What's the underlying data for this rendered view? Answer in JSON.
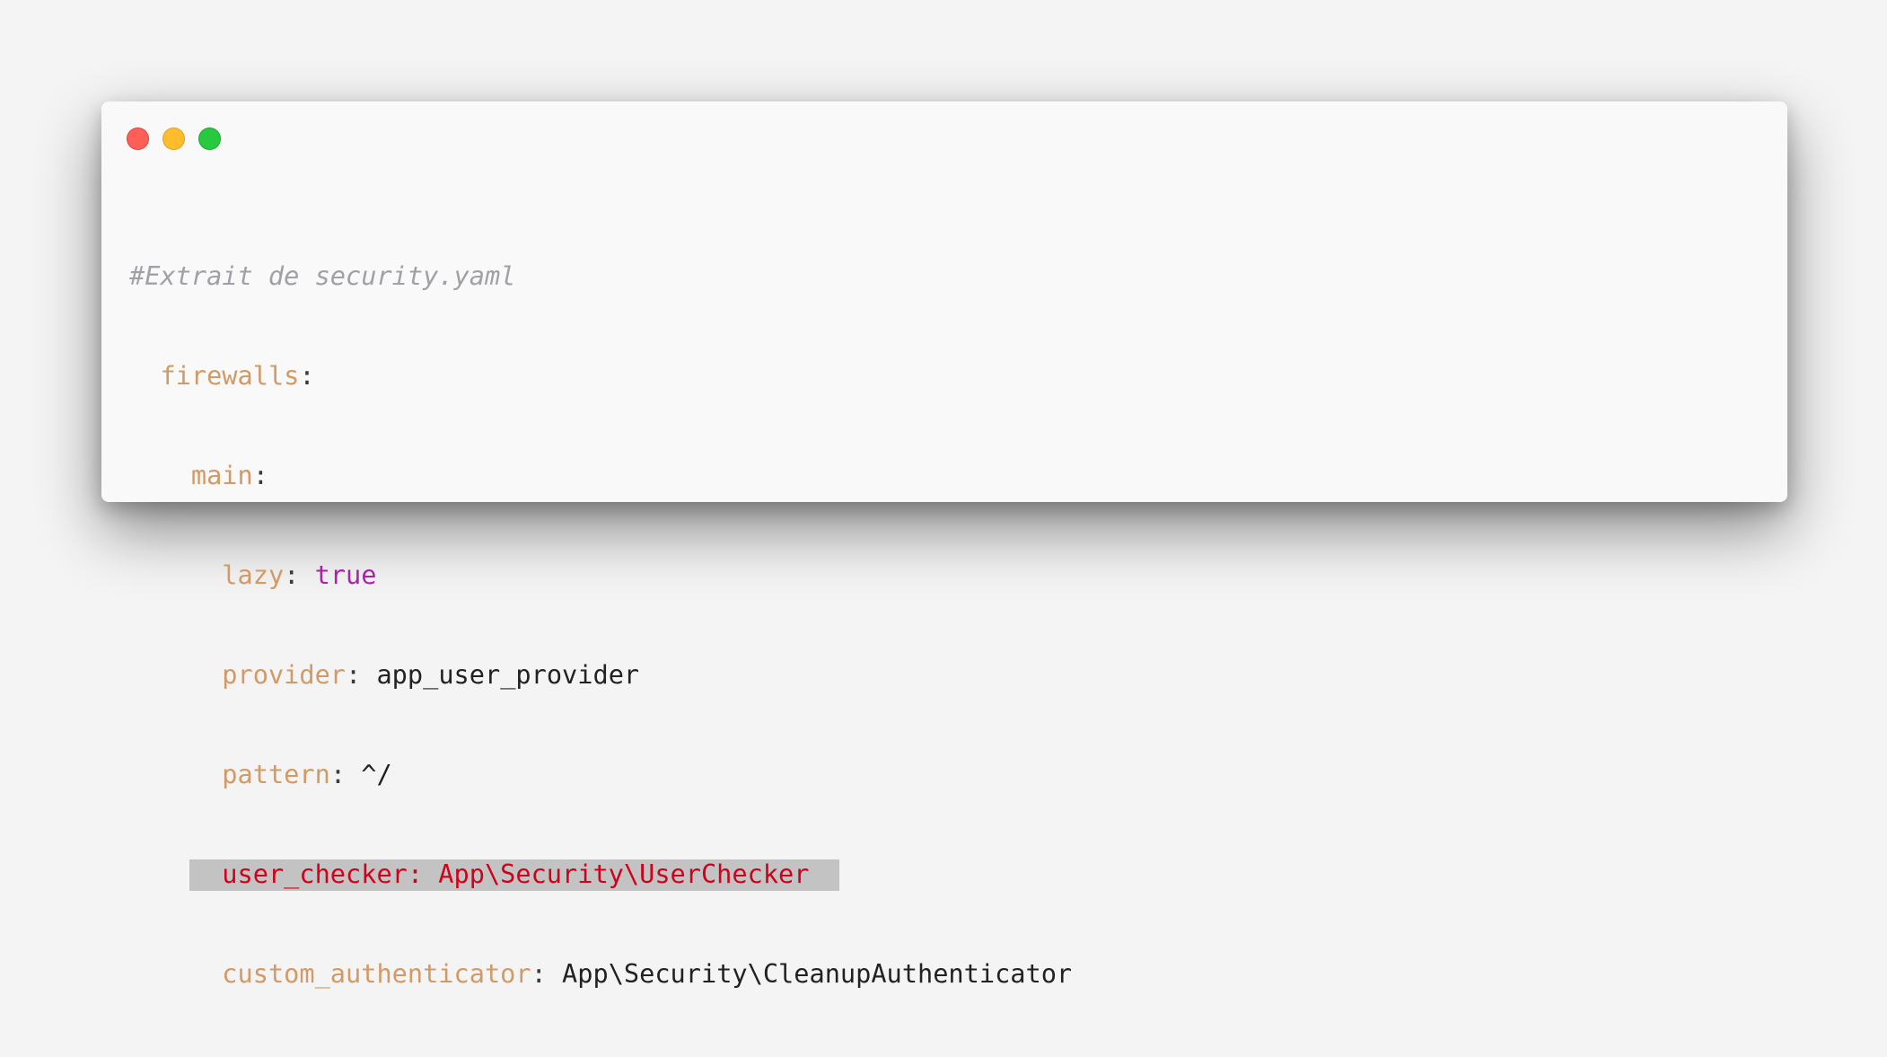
{
  "window": {
    "controls": [
      "close",
      "minimize",
      "maximize"
    ],
    "colors": {
      "close": "#ff5f56",
      "minimize": "#ffbd2e",
      "maximize": "#27c93f"
    }
  },
  "code": {
    "comment": "#Extrait de security.yaml",
    "firewalls_key": "firewalls",
    "main_key": "main",
    "lazy_key": "lazy",
    "lazy_value": "true",
    "provider_key": "provider",
    "provider_value": "app_user_provider",
    "pattern_key": "pattern",
    "pattern_value": "^/",
    "user_checker_line": "user_checker: App\\Security\\UserChecker",
    "custom_authenticator_key": "custom_authenticator",
    "custom_authenticator_value": "App\\Security\\CleanupAuthenticator",
    "separator": ": ",
    "colon": ":"
  },
  "colors": {
    "key": "#d19a66",
    "comment": "#a0a1a7",
    "boolean": "#a626a4",
    "highlight_text": "#d0021b",
    "highlight_background": "#c3c3c3"
  }
}
